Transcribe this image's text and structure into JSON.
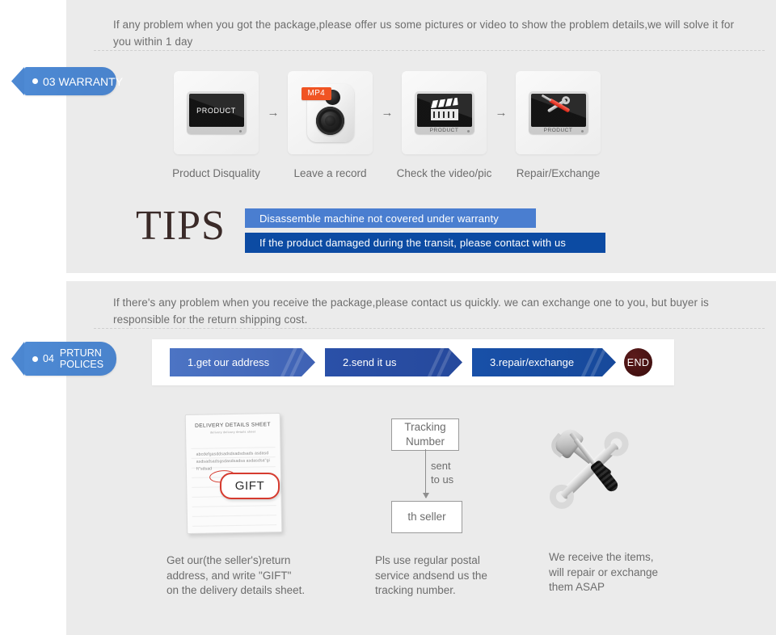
{
  "warranty_section": {
    "intro": "If any problem when you got the package,please offer us some pictures or video to show the problem details,we will solve\n it for you within 1 day",
    "badge": {
      "number": "03",
      "label": "WARRANTY"
    },
    "steps": [
      {
        "label": "Product Disquality",
        "icon": "monitor-icon",
        "screen_text": "PRODUCT",
        "base_text": ""
      },
      {
        "label": "Leave a record",
        "icon": "camera-icon",
        "tag": "MP4"
      },
      {
        "label": "Check the video/pic",
        "icon": "clapperboard-monitor-icon",
        "base_text": "PRODUCT"
      },
      {
        "label": "Repair/Exchange",
        "icon": "tools-monitor-icon",
        "base_text": "PRODUCT"
      }
    ],
    "step_arrow": "→",
    "tips": {
      "word": "TIPS",
      "bars": [
        {
          "text": "Disassemble machine not covered under warranty",
          "color": "#4a7ed0"
        },
        {
          "text": "If the product damaged during the transit, please contact with us",
          "color": "#0c4ba3"
        }
      ]
    }
  },
  "return_section": {
    "intro": "If  there's any problem when you receive the package,please contact us quickly. we can exchange one to you, but buyer is\nresponsible for the return shipping cost.",
    "badge": {
      "number": "04",
      "label": "PRTURN\nPOLICES"
    },
    "flow": {
      "steps": [
        {
          "text": "1.get our address",
          "color": "#4c74c4"
        },
        {
          "text": "2.send it us",
          "color": "#2a50a8"
        },
        {
          "text": "3.repair/exchange",
          "color": "#1850a8"
        }
      ],
      "end": {
        "text": "END",
        "color": "#3a0d0d"
      }
    },
    "sheet": {
      "title": "DELIVERY DETAILS SHEET",
      "subtitle": "delivery            delivery details sheet",
      "body": "abcdefgasddsadsdsadsdsads asdasdasdsadsadsgsdasdsadsa asdasdsa\"gift\"sdsad",
      "callout": "GIFT"
    },
    "tracking": {
      "box_top": "Tracking\nNumber",
      "arrow_label": "sent\nto us",
      "box_bottom": "th seller"
    },
    "tools_icon": "hammer-wrench-screwdriver-icon",
    "captions": [
      "Get our(the seller's)return\naddress, and write \"GIFT\"\non the delivery details sheet.",
      "Pls use regular postal\nservice andsend us the\n tracking number.",
      "We receive the items,\nwill repair or exchange\n them ASAP"
    ]
  }
}
